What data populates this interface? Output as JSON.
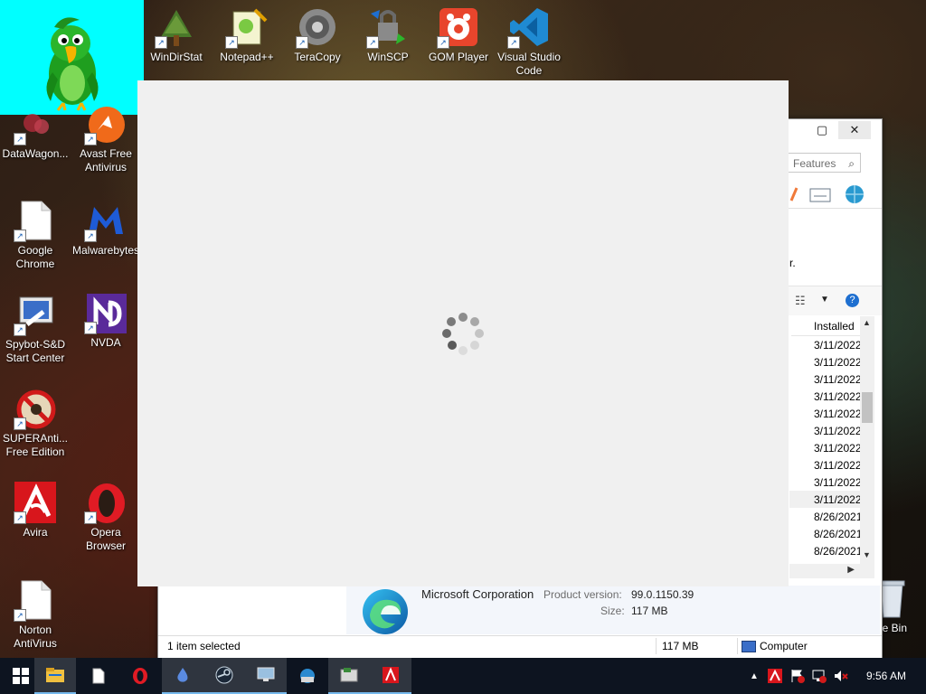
{
  "desktop": {
    "icons": [
      {
        "label": "WinDirStat",
        "icon": "windirstat-tree-icon"
      },
      {
        "label": "Notepad++",
        "icon": "notepadplusplus-icon"
      },
      {
        "label": "TeraCopy",
        "icon": "teracopy-icon"
      },
      {
        "label": "WinSCP",
        "icon": "winscp-icon"
      },
      {
        "label": "GOM Player",
        "icon": "gom-player-icon"
      },
      {
        "label": "Visual Studio Code",
        "icon": "vscode-icon"
      },
      {
        "label": "DataWagon...",
        "icon": "datawagon-icon"
      },
      {
        "label": "Avast Free Antivirus",
        "icon": "avast-icon"
      },
      {
        "label": "Google Chrome",
        "icon": "blank-file-icon"
      },
      {
        "label": "Malwarebytes",
        "icon": "malwarebytes-icon"
      },
      {
        "label": "Spybot-S&D Start Center",
        "icon": "spybot-icon"
      },
      {
        "label": "NVDA",
        "icon": "nvda-icon"
      },
      {
        "label": "SUPERAnti... Free Edition",
        "icon": "superantispyware-icon"
      },
      {
        "label": "Avira",
        "icon": "avira-icon"
      },
      {
        "label": "Opera Browser",
        "icon": "opera-icon"
      },
      {
        "label": "Norton AntiVirus",
        "icon": "blank-file-icon"
      },
      {
        "label": "cle Bin",
        "icon": "recycle-bin-icon"
      }
    ]
  },
  "programs_window": {
    "search_placeholder": "Features",
    "column_header": "Installed",
    "installed_dates": [
      "3/11/2022",
      "3/11/2022",
      "3/11/2022",
      "3/11/2022",
      "3/11/2022",
      "3/11/2022",
      "3/11/2022",
      "3/11/2022",
      "3/11/2022",
      "3/11/2022",
      "8/26/2021",
      "8/26/2021",
      "8/26/2021"
    ],
    "stray_text": "r.",
    "details": {
      "publisher": "Microsoft Corporation",
      "product_version_label": "Product version:",
      "product_version": "99.0.1150.39",
      "size_label": "Size:",
      "size": "117 MB"
    },
    "status": {
      "selection": "1 item selected",
      "size": "117 MB",
      "location": "Computer"
    }
  },
  "loading_window": {
    "state": "loading"
  },
  "taskbar": {
    "items": [
      {
        "icon": "windows-start-icon",
        "running": false
      },
      {
        "icon": "file-explorer-icon",
        "running": true
      },
      {
        "icon": "blank-document-icon",
        "running": false
      },
      {
        "icon": "opera-icon",
        "running": false
      },
      {
        "icon": "water-drop-app-icon",
        "running": true
      },
      {
        "icon": "steam-icon",
        "running": true
      },
      {
        "icon": "monitor-app-icon",
        "running": true
      },
      {
        "icon": "edge-setup-icon",
        "running": false
      },
      {
        "icon": "programs-features-icon",
        "running": true
      },
      {
        "icon": "avira-icon",
        "running": true
      }
    ],
    "tray": [
      "show-hidden-icons-chevron",
      "avira-tray-icon",
      "flag-error-icon",
      "network-error-icon",
      "volume-muted-icon"
    ],
    "clock": "9:56 AM"
  },
  "colors": {
    "parrot_background": "#00ffff",
    "taskbar": "#0d1420",
    "loading_window": "#f0f0f0"
  }
}
